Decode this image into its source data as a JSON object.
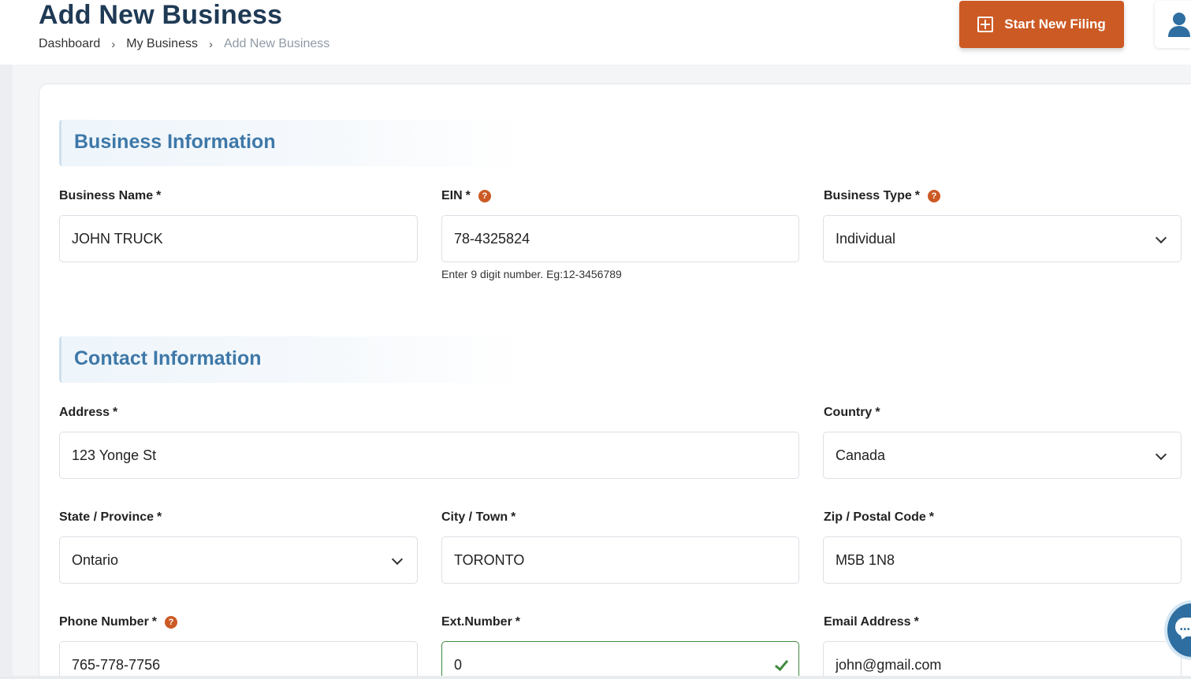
{
  "header": {
    "title": "Add New Business",
    "breadcrumb": [
      "Dashboard",
      "My Business",
      "Add New Business"
    ],
    "start_filing_label": "Start New Filing",
    "accent_color": "#cc5a24"
  },
  "sections": {
    "business": {
      "title": "Business Information",
      "business_name": {
        "label": "Business Name",
        "required": "*",
        "value": "JOHN TRUCK"
      },
      "ein": {
        "label": "EIN",
        "required": "*",
        "value": "78-4325824",
        "hint": "Enter 9 digit number. Eg:12-3456789",
        "help_icon": "?"
      },
      "business_type": {
        "label": "Business Type",
        "required": "*",
        "value": "Individual",
        "help_icon": "?"
      }
    },
    "contact": {
      "title": "Contact Information",
      "address": {
        "label": "Address",
        "required": "*",
        "value": "123 Yonge St"
      },
      "country": {
        "label": "Country",
        "required": "*",
        "value": "Canada"
      },
      "state": {
        "label": "State / Province",
        "required": "*",
        "value": "Ontario"
      },
      "city": {
        "label": "City / Town",
        "required": "*",
        "value": "TORONTO"
      },
      "zip": {
        "label": "Zip / Postal Code",
        "required": "*",
        "value": "M5B 1N8"
      },
      "phone": {
        "label": "Phone Number",
        "required": "*",
        "value": "765-778-7756",
        "help_icon": "?"
      },
      "ext": {
        "label": "Ext.Number",
        "required": "*",
        "value": "0"
      },
      "email": {
        "label": "Email Address",
        "required": "*",
        "value": "john@gmail.com"
      }
    }
  },
  "icons": {
    "plus": "plus-icon",
    "user": "user-icon",
    "chevron": "chevron-down-icon",
    "check": "check-icon",
    "help": "help-icon",
    "chat": "chat-icon"
  }
}
